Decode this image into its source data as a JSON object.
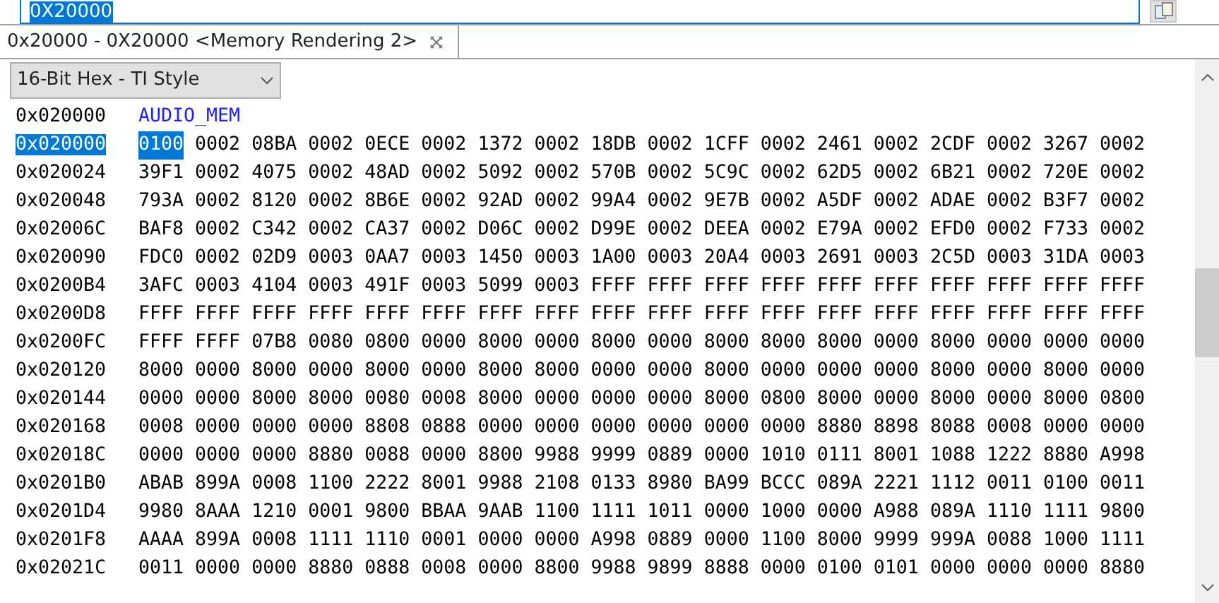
{
  "address_field": {
    "value": "0X20000",
    "selected": true
  },
  "tab": {
    "label": "0x20000 - 0X20000 <Memory Rendering 2>",
    "selected": true
  },
  "format_select": {
    "value": "16-Bit Hex - TI Style"
  },
  "label_row": {
    "address": "0x020000",
    "label": "AUDIO_MEM"
  },
  "rows": [
    {
      "address": "0x020000",
      "address_selected": true,
      "first_word_selected": true,
      "words": [
        "0100",
        "0002",
        "08BA",
        "0002",
        "0ECE",
        "0002",
        "1372",
        "0002",
        "18DB",
        "0002",
        "1CFF",
        "0002",
        "2461",
        "0002",
        "2CDF",
        "0002",
        "3267",
        "0002"
      ]
    },
    {
      "address": "0x020024",
      "address_selected": false,
      "first_word_selected": false,
      "words": [
        "39F1",
        "0002",
        "4075",
        "0002",
        "48AD",
        "0002",
        "5092",
        "0002",
        "570B",
        "0002",
        "5C9C",
        "0002",
        "62D5",
        "0002",
        "6B21",
        "0002",
        "720E",
        "0002"
      ]
    },
    {
      "address": "0x020048",
      "address_selected": false,
      "first_word_selected": false,
      "words": [
        "793A",
        "0002",
        "8120",
        "0002",
        "8B6E",
        "0002",
        "92AD",
        "0002",
        "99A4",
        "0002",
        "9E7B",
        "0002",
        "A5DF",
        "0002",
        "ADAE",
        "0002",
        "B3F7",
        "0002"
      ]
    },
    {
      "address": "0x02006C",
      "address_selected": false,
      "first_word_selected": false,
      "words": [
        "BAF8",
        "0002",
        "C342",
        "0002",
        "CA37",
        "0002",
        "D06C",
        "0002",
        "D99E",
        "0002",
        "DEEA",
        "0002",
        "E79A",
        "0002",
        "EFD0",
        "0002",
        "F733",
        "0002"
      ]
    },
    {
      "address": "0x020090",
      "address_selected": false,
      "first_word_selected": false,
      "words": [
        "FDC0",
        "0002",
        "02D9",
        "0003",
        "0AA7",
        "0003",
        "1450",
        "0003",
        "1A00",
        "0003",
        "20A4",
        "0003",
        "2691",
        "0003",
        "2C5D",
        "0003",
        "31DA",
        "0003"
      ]
    },
    {
      "address": "0x0200B4",
      "address_selected": false,
      "first_word_selected": false,
      "words": [
        "3AFC",
        "0003",
        "4104",
        "0003",
        "491F",
        "0003",
        "5099",
        "0003",
        "FFFF",
        "FFFF",
        "FFFF",
        "FFFF",
        "FFFF",
        "FFFF",
        "FFFF",
        "FFFF",
        "FFFF",
        "FFFF"
      ]
    },
    {
      "address": "0x0200D8",
      "address_selected": false,
      "first_word_selected": false,
      "words": [
        "FFFF",
        "FFFF",
        "FFFF",
        "FFFF",
        "FFFF",
        "FFFF",
        "FFFF",
        "FFFF",
        "FFFF",
        "FFFF",
        "FFFF",
        "FFFF",
        "FFFF",
        "FFFF",
        "FFFF",
        "FFFF",
        "FFFF",
        "FFFF"
      ]
    },
    {
      "address": "0x0200FC",
      "address_selected": false,
      "first_word_selected": false,
      "words": [
        "FFFF",
        "FFFF",
        "07B8",
        "0080",
        "0800",
        "0000",
        "8000",
        "0000",
        "8000",
        "0000",
        "8000",
        "8000",
        "8000",
        "0000",
        "8000",
        "0000",
        "0000",
        "0000"
      ]
    },
    {
      "address": "0x020120",
      "address_selected": false,
      "first_word_selected": false,
      "words": [
        "8000",
        "0000",
        "8000",
        "0000",
        "8000",
        "0000",
        "8000",
        "8000",
        "0000",
        "0000",
        "8000",
        "0000",
        "0000",
        "0000",
        "8000",
        "0000",
        "8000",
        "0000"
      ]
    },
    {
      "address": "0x020144",
      "address_selected": false,
      "first_word_selected": false,
      "words": [
        "0000",
        "0000",
        "8000",
        "8000",
        "0080",
        "0008",
        "8000",
        "0000",
        "0000",
        "0000",
        "8000",
        "0800",
        "8000",
        "0000",
        "8000",
        "0000",
        "8000",
        "0800"
      ]
    },
    {
      "address": "0x020168",
      "address_selected": false,
      "first_word_selected": false,
      "words": [
        "0008",
        "0000",
        "0000",
        "0000",
        "8808",
        "0888",
        "0000",
        "0000",
        "0000",
        "0000",
        "0000",
        "0000",
        "8880",
        "8898",
        "8088",
        "0008",
        "0000",
        "0000"
      ]
    },
    {
      "address": "0x02018C",
      "address_selected": false,
      "first_word_selected": false,
      "words": [
        "0000",
        "0000",
        "0000",
        "8880",
        "0088",
        "0000",
        "8800",
        "9988",
        "9999",
        "0889",
        "0000",
        "1010",
        "0111",
        "8001",
        "1088",
        "1222",
        "8880",
        "A998"
      ]
    },
    {
      "address": "0x0201B0",
      "address_selected": false,
      "first_word_selected": false,
      "words": [
        "ABAB",
        "899A",
        "0008",
        "1100",
        "2222",
        "8001",
        "9988",
        "2108",
        "0133",
        "8980",
        "BA99",
        "BCCC",
        "089A",
        "2221",
        "1112",
        "0011",
        "0100",
        "0011"
      ]
    },
    {
      "address": "0x0201D4",
      "address_selected": false,
      "first_word_selected": false,
      "words": [
        "9980",
        "8AAA",
        "1210",
        "0001",
        "9800",
        "BBAA",
        "9AAB",
        "1100",
        "1111",
        "1011",
        "0000",
        "1000",
        "0000",
        "A988",
        "089A",
        "1110",
        "1111",
        "9800"
      ]
    },
    {
      "address": "0x0201F8",
      "address_selected": false,
      "first_word_selected": false,
      "words": [
        "AAAA",
        "899A",
        "0008",
        "1111",
        "1110",
        "0001",
        "0000",
        "0000",
        "A998",
        "0889",
        "0000",
        "1100",
        "8000",
        "9999",
        "999A",
        "0088",
        "1000",
        "1111"
      ]
    },
    {
      "address": "0x02021C",
      "address_selected": false,
      "first_word_selected": false,
      "words": [
        "0011",
        "0000",
        "0000",
        "8880",
        "0888",
        "0008",
        "0000",
        "8800",
        "9988",
        "9899",
        "8888",
        "0000",
        "0100",
        "0101",
        "0000",
        "0000",
        "0000",
        "8880"
      ]
    }
  ]
}
